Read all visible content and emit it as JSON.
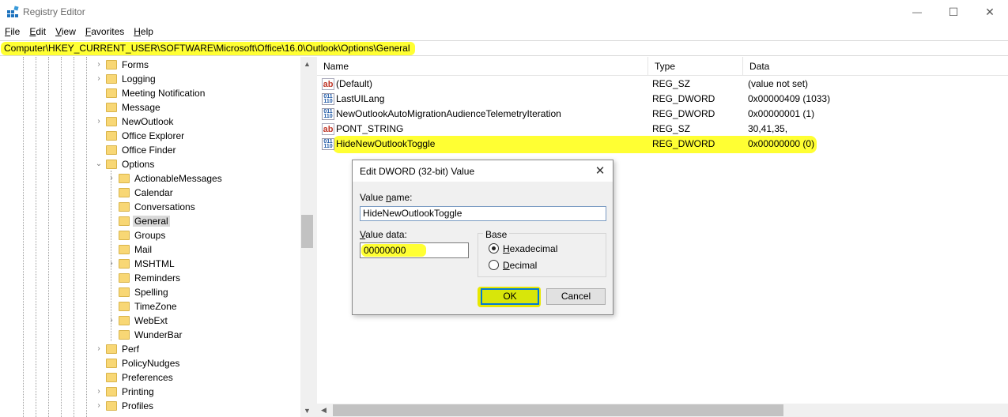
{
  "window": {
    "title": "Registry Editor",
    "controls": [
      "—",
      "☐",
      "✕"
    ]
  },
  "menu": [
    {
      "label": "File",
      "u": "F",
      "rest": "ile"
    },
    {
      "label": "Edit",
      "u": "E",
      "rest": "dit"
    },
    {
      "label": "View",
      "u": "V",
      "rest": "iew"
    },
    {
      "label": "Favorites",
      "u": "F",
      "rest": "avorites",
      "pre": ""
    },
    {
      "label": "Help",
      "u": "H",
      "rest": "elp"
    }
  ],
  "address": "Computer\\HKEY_CURRENT_USER\\SOFTWARE\\Microsoft\\Office\\16.0\\Outlook\\Options\\General",
  "tree": [
    {
      "label": "Forms",
      "level": 1,
      "expander": "›"
    },
    {
      "label": "Logging",
      "level": 1,
      "expander": "›"
    },
    {
      "label": "Meeting Notification",
      "level": 1,
      "expander": ""
    },
    {
      "label": "Message",
      "level": 1,
      "expander": ""
    },
    {
      "label": "NewOutlook",
      "level": 1,
      "expander": "›"
    },
    {
      "label": "Office Explorer",
      "level": 1,
      "expander": ""
    },
    {
      "label": "Office Finder",
      "level": 1,
      "expander": ""
    },
    {
      "label": "Options",
      "level": 1,
      "expander": "⌄"
    },
    {
      "label": "ActionableMessages",
      "level": 2,
      "expander": "›"
    },
    {
      "label": "Calendar",
      "level": 2,
      "expander": ""
    },
    {
      "label": "Conversations",
      "level": 2,
      "expander": ""
    },
    {
      "label": "General",
      "level": 2,
      "expander": "",
      "selected": true
    },
    {
      "label": "Groups",
      "level": 2,
      "expander": ""
    },
    {
      "label": "Mail",
      "level": 2,
      "expander": ""
    },
    {
      "label": "MSHTML",
      "level": 2,
      "expander": "›"
    },
    {
      "label": "Reminders",
      "level": 2,
      "expander": ""
    },
    {
      "label": "Spelling",
      "level": 2,
      "expander": ""
    },
    {
      "label": "TimeZone",
      "level": 2,
      "expander": ""
    },
    {
      "label": "WebExt",
      "level": 2,
      "expander": "›"
    },
    {
      "label": "WunderBar",
      "level": 2,
      "expander": ""
    },
    {
      "label": "Perf",
      "level": 1,
      "expander": "›"
    },
    {
      "label": "PolicyNudges",
      "level": 1,
      "expander": ""
    },
    {
      "label": "Preferences",
      "level": 1,
      "expander": ""
    },
    {
      "label": "Printing",
      "level": 1,
      "expander": "›"
    },
    {
      "label": "Profiles",
      "level": 1,
      "expander": "›"
    }
  ],
  "list": {
    "columns": [
      "Name",
      "Type",
      "Data"
    ],
    "rows": [
      {
        "name": "(Default)",
        "type": "REG_SZ",
        "data": "(value not set)",
        "icon": "string-value-icon"
      },
      {
        "name": "LastUILang",
        "type": "REG_DWORD",
        "data": "0x00000409 (1033)",
        "icon": "dword-value-icon"
      },
      {
        "name": "NewOutlookAutoMigrationAudienceTelemetryIteration",
        "type": "REG_DWORD",
        "data": "0x00000001 (1)",
        "icon": "dword-value-icon"
      },
      {
        "name": "PONT_STRING",
        "type": "REG_SZ",
        "data": "30,41,35,",
        "icon": "string-value-icon"
      },
      {
        "name": "HideNewOutlookToggle",
        "type": "REG_DWORD",
        "data": "0x00000000 (0)",
        "icon": "dword-value-icon",
        "highlighted": true
      }
    ]
  },
  "dialog": {
    "title": "Edit DWORD (32-bit) Value",
    "close": "✕",
    "value_name_label_pre": "Value ",
    "value_name_label_u": "n",
    "value_name_label_post": "ame:",
    "value_name": "HideNewOutlookToggle",
    "value_data_label_pre": "",
    "value_data_label_u": "V",
    "value_data_label_post": "alue data:",
    "value_data": "00000000",
    "base_label": "Base",
    "hex_u": "H",
    "hex_rest": "exadecimal",
    "dec_u": "D",
    "dec_rest": "ecimal",
    "ok": "OK",
    "cancel": "Cancel"
  },
  "colors": {
    "highlight": "#ffff33",
    "folder": "#f8d775",
    "focus": "#0078d7"
  }
}
